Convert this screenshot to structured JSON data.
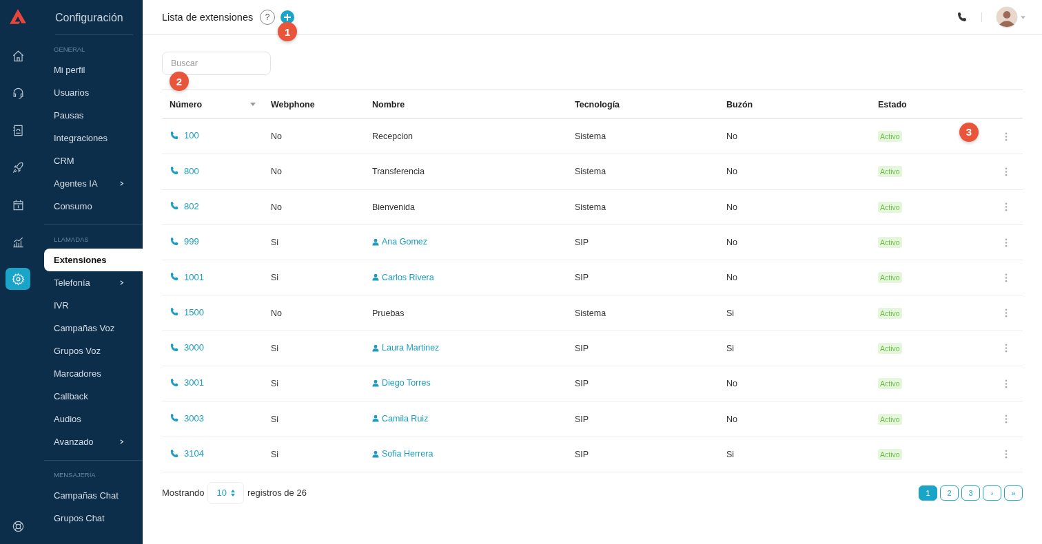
{
  "rail": {
    "items": [
      {
        "selected": false
      },
      {
        "selected": false
      },
      {
        "selected": false
      },
      {
        "selected": false
      },
      {
        "selected": false
      },
      {
        "selected": false
      },
      {
        "selected": true
      }
    ]
  },
  "sidebar": {
    "title": "Configuración",
    "sections": [
      {
        "heading": "GENERAL",
        "items": [
          {
            "label": "Mi perfil",
            "submenu": false,
            "selected": false
          },
          {
            "label": "Usuarios",
            "submenu": false,
            "selected": false
          },
          {
            "label": "Pausas",
            "submenu": false,
            "selected": false
          },
          {
            "label": "Integraciones",
            "submenu": false,
            "selected": false
          },
          {
            "label": "CRM",
            "submenu": false,
            "selected": false
          },
          {
            "label": "Agentes IA",
            "submenu": true,
            "selected": false
          },
          {
            "label": "Consumo",
            "submenu": false,
            "selected": false
          }
        ]
      },
      {
        "heading": "LLAMADAS",
        "items": [
          {
            "label": "Extensiones",
            "submenu": false,
            "selected": true
          },
          {
            "label": "Telefonía",
            "submenu": true,
            "selected": false
          },
          {
            "label": "IVR",
            "submenu": false,
            "selected": false
          },
          {
            "label": "Campañas Voz",
            "submenu": false,
            "selected": false
          },
          {
            "label": "Grupos Voz",
            "submenu": false,
            "selected": false
          },
          {
            "label": "Marcadores",
            "submenu": false,
            "selected": false
          },
          {
            "label": "Callback",
            "submenu": false,
            "selected": false
          },
          {
            "label": "Audios",
            "submenu": false,
            "selected": false
          },
          {
            "label": "Avanzado",
            "submenu": true,
            "selected": false
          }
        ]
      },
      {
        "heading": "MENSAJERÍA",
        "items": [
          {
            "label": "Campañas Chat",
            "submenu": false,
            "selected": false
          },
          {
            "label": "Grupos Chat",
            "submenu": false,
            "selected": false
          }
        ]
      }
    ]
  },
  "header": {
    "title": "Lista de extensiones",
    "help": "?",
    "marker": "1"
  },
  "search": {
    "placeholder": "Buscar",
    "marker": "2"
  },
  "table": {
    "columns": [
      {
        "label": "Número",
        "sorted": true
      },
      {
        "label": "Webphone",
        "sorted": false
      },
      {
        "label": "Nombre",
        "sorted": false
      },
      {
        "label": "Tecnología",
        "sorted": false
      },
      {
        "label": "Buzón",
        "sorted": false
      },
      {
        "label": "Estado",
        "sorted": false
      }
    ],
    "rows": [
      {
        "number": "100",
        "webphone": "No",
        "name": "Recepcion",
        "kind": "plain",
        "technology": "Sistema",
        "voicemail": "No",
        "status": "Activo",
        "marker": "3"
      },
      {
        "number": "800",
        "webphone": "No",
        "name": "Transferencia",
        "kind": "plain",
        "technology": "Sistema",
        "voicemail": "No",
        "status": "Activo"
      },
      {
        "number": "802",
        "webphone": "No",
        "name": "Bienvenida",
        "kind": "plain",
        "technology": "Sistema",
        "voicemail": "No",
        "status": "Activo"
      },
      {
        "number": "999",
        "webphone": "Si",
        "name": "Ana Gomez",
        "kind": "user",
        "technology": "SIP",
        "voicemail": "No",
        "status": "Activo"
      },
      {
        "number": "1001",
        "webphone": "Si",
        "name": "Carlos Rivera",
        "kind": "user",
        "technology": "SIP",
        "voicemail": "No",
        "status": "Activo"
      },
      {
        "number": "1500",
        "webphone": "No",
        "name": "Pruebas",
        "kind": "plain",
        "technology": "Sistema",
        "voicemail": "Si",
        "status": "Activo"
      },
      {
        "number": "3000",
        "webphone": "Si",
        "name": "Laura Martinez",
        "kind": "user",
        "technology": "SIP",
        "voicemail": "Si",
        "status": "Activo"
      },
      {
        "number": "3001",
        "webphone": "Si",
        "name": "Diego Torres",
        "kind": "user",
        "technology": "SIP",
        "voicemail": "No",
        "status": "Activo"
      },
      {
        "number": "3003",
        "webphone": "Si",
        "name": "Camila Ruiz",
        "kind": "user",
        "technology": "SIP",
        "voicemail": "No",
        "status": "Activo"
      },
      {
        "number": "3104",
        "webphone": "Si",
        "name": "Sofia Herrera",
        "kind": "user",
        "technology": "SIP",
        "voicemail": "Si",
        "status": "Activo"
      }
    ]
  },
  "footer": {
    "showing": "Mostrando",
    "page_size": "10",
    "total": "registros de 26",
    "pages": [
      {
        "label": "1",
        "selected": true
      },
      {
        "label": "2",
        "selected": false
      },
      {
        "label": "3",
        "selected": false
      },
      {
        "label": "›",
        "selected": false
      },
      {
        "label": "»",
        "selected": false
      }
    ]
  }
}
